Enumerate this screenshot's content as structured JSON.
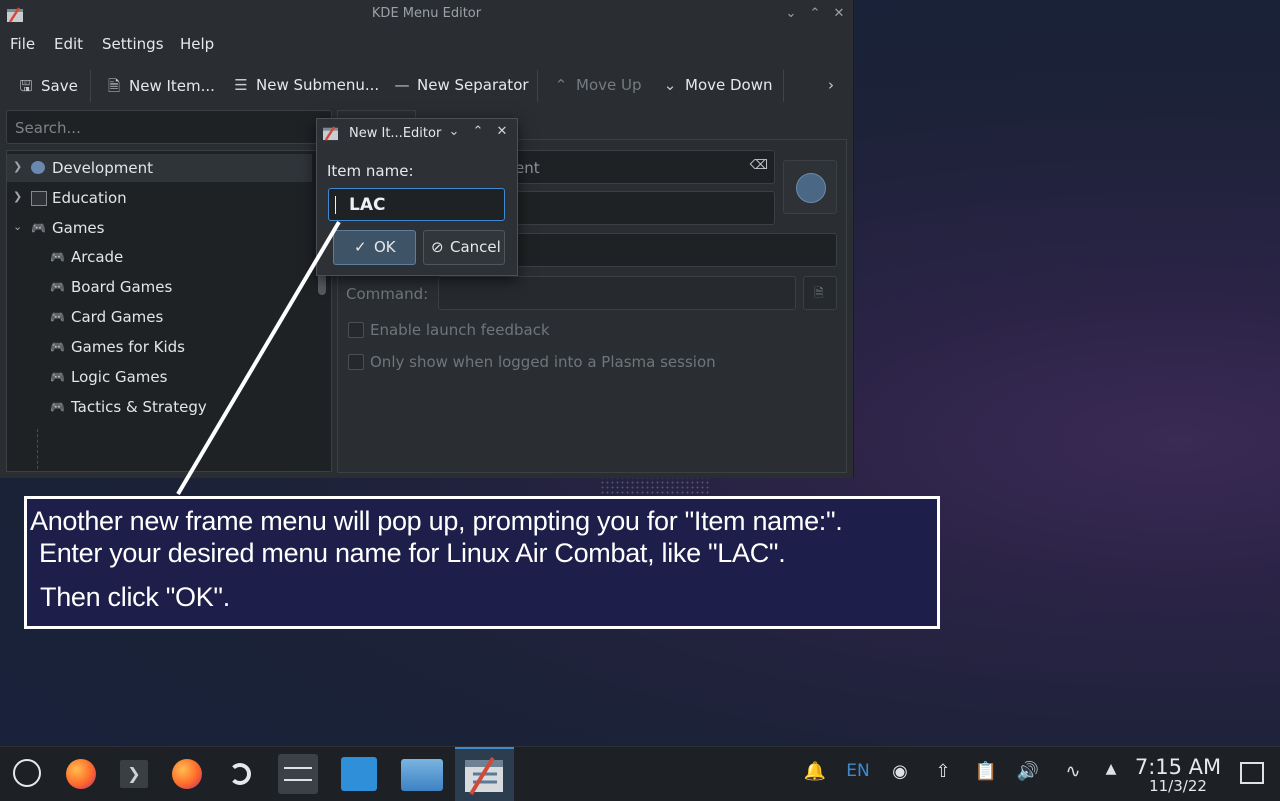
{
  "window": {
    "title": "KDE Menu Editor",
    "menu": [
      "File",
      "Edit",
      "Settings",
      "Help"
    ],
    "toolbar": {
      "save": "Save",
      "new_item": "New Item...",
      "new_submenu": "New Submenu...",
      "new_separator": "New Separator",
      "move_up": "Move Up",
      "move_down": "Move Down"
    },
    "search_placeholder": "Search...",
    "tree": [
      {
        "label": "Development",
        "expanded": false,
        "selected": true
      },
      {
        "label": "Education",
        "expanded": false
      },
      {
        "label": "Games",
        "expanded": true
      },
      {
        "label": "Arcade"
      },
      {
        "label": "Board Games"
      },
      {
        "label": "Card Games"
      },
      {
        "label": "Games for Kids"
      },
      {
        "label": "Logic Games"
      },
      {
        "label": "Tactics & Strategy"
      }
    ],
    "right_pane": {
      "name_fragment": "ent",
      "command_label": "Command:",
      "enable_launch_feedback": "Enable launch feedback",
      "only_show_plasma": "Only show when logged into a Plasma session"
    }
  },
  "dialog": {
    "title": "New It...Editor",
    "label": "Item name:",
    "value": "LAC",
    "ok": "OK",
    "cancel": "Cancel"
  },
  "callout": {
    "line1": "Another new frame menu will pop up, prompting you for \"Item name:\".",
    "line2": "Enter your desired menu name for Linux Air Combat, like \"LAC\".",
    "line3": "Then click \"OK\"."
  },
  "taskbar": {
    "language": "EN",
    "time": "7:15 AM",
    "date": "11/3/22"
  }
}
